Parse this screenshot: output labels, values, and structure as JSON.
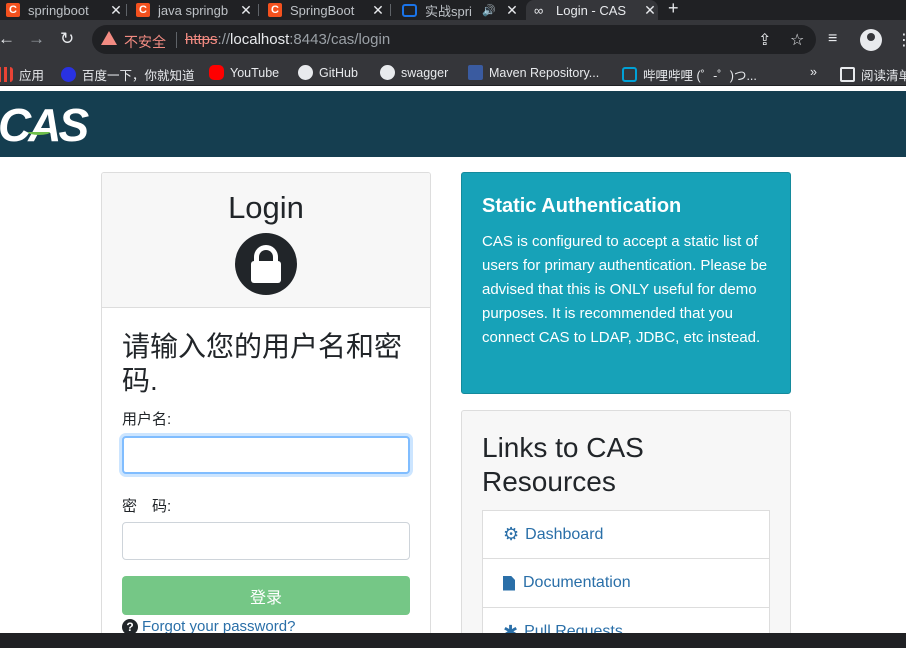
{
  "tabs": [
    {
      "label": "springboot"
    },
    {
      "label": "java springb"
    },
    {
      "label": "SpringBoot"
    },
    {
      "label": "实战spri"
    },
    {
      "label": "Login - CAS"
    }
  ],
  "toolbar": {
    "security_label": "不安全",
    "url_scheme": "https",
    "url_sep": "://",
    "url_host": "localhost",
    "url_rest": ":8443/cas/login"
  },
  "bookmarks": [
    {
      "label": "应用",
      "color": "#ea4335"
    },
    {
      "label": "百度一下，你就知道",
      "color": "#2932e1"
    },
    {
      "label": "YouTube",
      "color": "#ff0000"
    },
    {
      "label": "GitHub",
      "color": "#e8eaed"
    },
    {
      "label": "swagger",
      "color": "#e8eaed"
    },
    {
      "label": "Maven Repository...",
      "color": "#3a5ba0"
    },
    {
      "label": "哔哩哔哩 (゜-゜)つ...",
      "color": "#00a1d6"
    },
    {
      "label": "阅读清单",
      "color": "#e8eaed"
    }
  ],
  "brand": {
    "logo_text": "CAS"
  },
  "login": {
    "title": "Login",
    "prompt": "请输入您的用户名和密码.",
    "username_label": "用户名:",
    "username_value": "",
    "password_label": "密　码:",
    "password_value": "",
    "submit_label": "登录",
    "forgot_label": "Forgot your password?"
  },
  "static_auth": {
    "title": "Static Authentication",
    "body": "CAS is configured to accept a static list of users for primary authentication. Please be advised that this is ONLY useful for demo purposes. It is recommended that you connect CAS to LDAP, JDBC, etc instead."
  },
  "resources": {
    "title": "Links to CAS Resources",
    "links": [
      {
        "label": "Dashboard",
        "icon": "gears-icon"
      },
      {
        "label": "Documentation",
        "icon": "file-icon"
      },
      {
        "label": "Pull Requests",
        "icon": "bug-icon"
      }
    ]
  },
  "colors": {
    "header_bg": "#153e50",
    "info_bg": "#17a2b8",
    "login_button": "#75c786",
    "link": "#2a6fa8"
  }
}
